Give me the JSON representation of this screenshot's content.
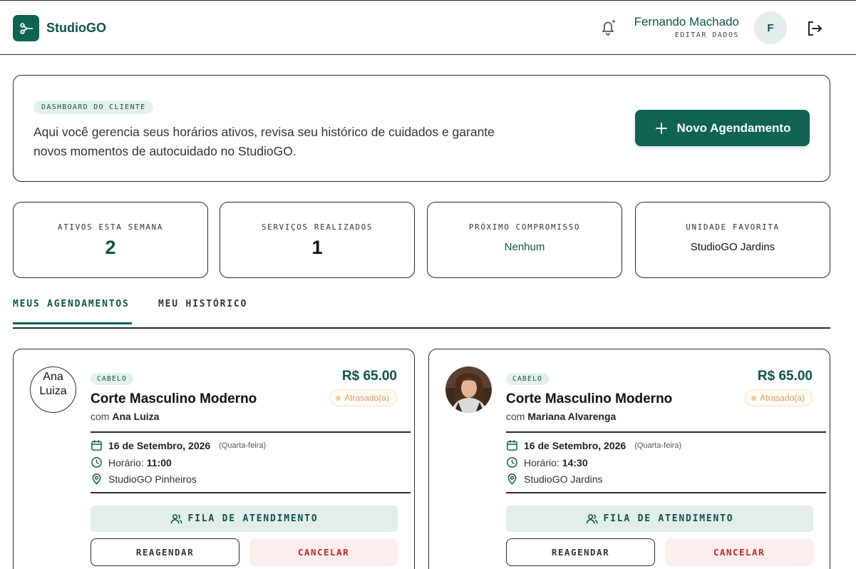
{
  "header": {
    "brand": "StudioGO",
    "user_name": "Fernando Machado",
    "edit_label": "EDITAR DADOS",
    "avatar_initial": "F",
    "icons": [
      "scissors-icon",
      "bell-icon",
      "logout-icon"
    ]
  },
  "welcome": {
    "tag": "DASHBOARD DO CLIENTE",
    "text": "Aqui você gerencia seus horários ativos, revisa seu histórico de cuidados e garante novos momentos de autocuidado no StudioGO.",
    "new_button": "Novo Agendamento"
  },
  "stats": [
    {
      "label": "ATIVOS ESTA SEMANA",
      "value": "2"
    },
    {
      "label": "SERVIÇOS REALIZADOS",
      "value": "1"
    },
    {
      "label": "PRÓXIMO COMPROMISSO",
      "value": "Nenhum"
    },
    {
      "label": "UNIDADE FAVORITA",
      "value": "StudioGO Jardins"
    }
  ],
  "tabs": {
    "active": "MEUS AGENDAMENTOS",
    "inactive": "MEU HISTÓRICO"
  },
  "appointments": [
    {
      "photo_alt": "Ana Luiza",
      "category": "CABELO",
      "service": "Corte Masculino Moderno",
      "with_prefix": "com",
      "professional": "Ana Luiza",
      "price": "R$ 65.00",
      "status": "Atrasado(a)",
      "date": "16 de Setembro, 2026",
      "weekday": "(Quarta-feira)",
      "time_label": "Horário:",
      "time": "11:00",
      "location": "StudioGO Pinheiros",
      "queue_button": "FILA DE ATENDIMENTO",
      "reschedule_button": "REAGENDAR",
      "cancel_button": "CANCELAR"
    },
    {
      "photo_alt": "Mariana Alvarenga",
      "category": "CABELO",
      "service": "Corte Masculino Moderno",
      "with_prefix": "com",
      "professional": "Mariana Alvarenga",
      "price": "R$ 65.00",
      "status": "Atrasado(a)",
      "date": "16 de Setembro, 2026",
      "weekday": "(Quarta-feira)",
      "time_label": "Horário:",
      "time": "14:30",
      "location": "StudioGO Jardins",
      "queue_button": "FILA DE ATENDIMENTO",
      "reschedule_button": "REAGENDAR",
      "cancel_button": "CANCELAR"
    }
  ],
  "colors": {
    "brand": "#0f6352",
    "brand_dark": "#0f5446",
    "danger": "#c62828",
    "warning": "#d39e6a"
  }
}
